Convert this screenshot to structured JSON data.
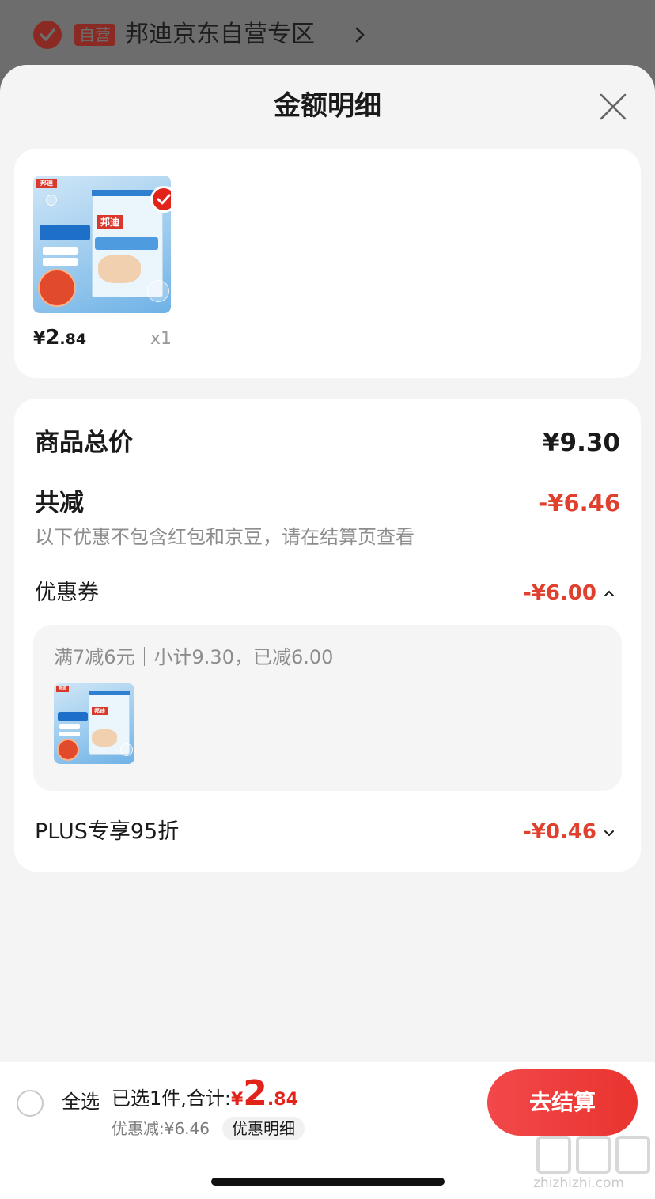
{
  "background": {
    "store_badge": "自营",
    "store_name": "邦迪京东自营专区"
  },
  "sheet": {
    "title": "金额明细"
  },
  "product": {
    "image_icon": "band-aid-product-image",
    "price_currency": "¥",
    "price_int": "2",
    "price_dec": ".84",
    "quantity": "x1"
  },
  "detail": {
    "total_label": "商品总价",
    "total_value": "¥9.30",
    "reduce_label": "共减",
    "reduce_value": "-¥6.46",
    "note": "以下优惠不包含红包和京豆，请在结算页查看",
    "coupon_label": "优惠券",
    "coupon_value": "-¥6.00",
    "coupon_rule": "满7减6元｜小计9.30，已减6.00",
    "plus_label": "PLUS专享95折",
    "plus_value": "-¥0.46"
  },
  "bottom": {
    "select_all": "全选",
    "selected_text": "已选1件,合计:",
    "total_currency": "¥",
    "total_int": "2",
    "total_dec": ".84",
    "discount_text": "优惠减:¥6.46",
    "detail_link": "优惠明细",
    "checkout_label": "去结算"
  },
  "watermark": {
    "text": "zhizhizhi.com"
  },
  "colors": {
    "accent_red": "#e2231a",
    "discount_red": "#e0402e",
    "sheet_bg": "#f4f4f4"
  }
}
